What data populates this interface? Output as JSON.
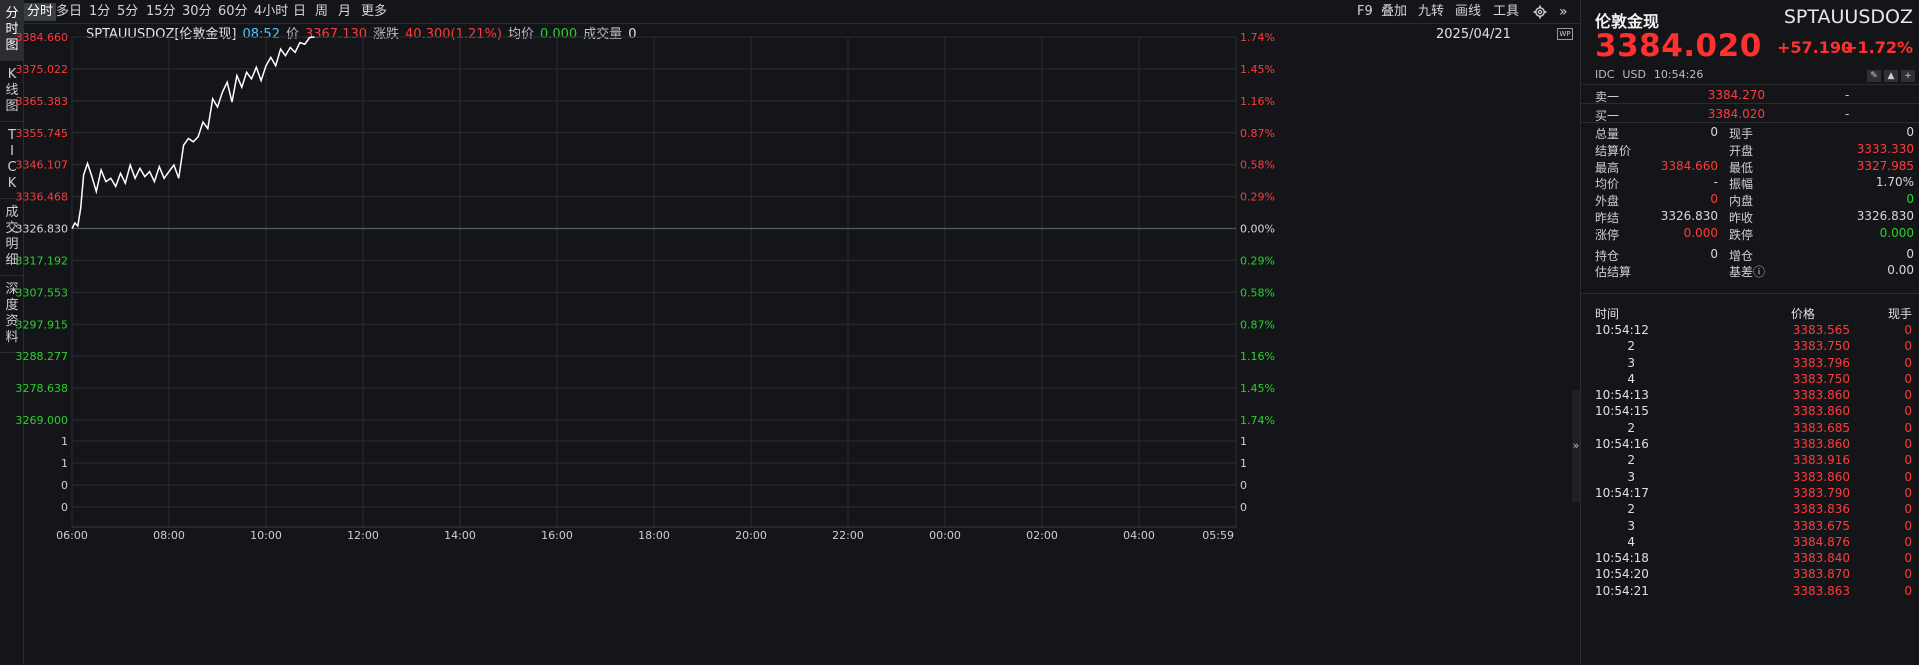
{
  "left_tabs": [
    "分时图",
    "K线图",
    "TICK",
    "成交明细",
    "深度资料"
  ],
  "toolbar": {
    "periods": [
      "分时",
      "多日",
      "1分",
      "5分",
      "15分",
      "30分",
      "60分",
      "4小时",
      "日",
      "周",
      "月",
      "更多"
    ],
    "right_buttons": [
      "F9",
      "叠加",
      "九转",
      "画线",
      "工具"
    ],
    "settings_icon": "gear-icon",
    "collapse_icon": "double-chevron-right-icon"
  },
  "info": {
    "symbol": "SPTAUUSDOZ[伦敦金现]",
    "time": "08:52",
    "price_label": "价",
    "price": "3367.130",
    "change_label": "涨跌",
    "change": "40.300(1.21%)",
    "avg_label": "均价",
    "avg": "0.000",
    "volume_label": "成交量",
    "volume": "0",
    "date": "2025/04/21",
    "wp_badge": "WP"
  },
  "colors": {
    "up": "#ff3b3b",
    "down": "#2bd12b",
    "neutral": "#d8d8d8",
    "line": "#ffffff",
    "background": "#141519",
    "grid": "#2b2d32"
  },
  "chart_data": {
    "type": "line",
    "x_ticks": [
      "06:00",
      "08:00",
      "10:00",
      "12:00",
      "14:00",
      "16:00",
      "18:00",
      "20:00",
      "22:00",
      "00:00",
      "02:00",
      "04:00",
      "05:59"
    ],
    "y_left_ticks": [
      "3384.660",
      "3375.022",
      "3365.383",
      "3355.745",
      "3346.107",
      "3336.468",
      "3326.830",
      "3317.192",
      "3307.553",
      "3297.915",
      "3288.277",
      "3278.638",
      "3269.000"
    ],
    "y_right_ticks": [
      "1.74%",
      "1.45%",
      "1.16%",
      "0.87%",
      "0.58%",
      "0.29%",
      "0.00%",
      "0.29%",
      "0.58%",
      "0.87%",
      "1.16%",
      "1.45%",
      "1.74%"
    ],
    "ylim": [
      3269.0,
      3384.66
    ],
    "base_price": 3326.83,
    "volume_ticks": [
      "1",
      "1",
      "0",
      "0"
    ],
    "series": [
      {
        "x_hours": [
          0.0,
          0.06,
          0.12,
          0.18,
          0.24,
          0.32,
          0.4,
          0.5,
          0.6,
          0.7,
          0.8,
          0.9,
          1.0,
          1.1,
          1.2,
          1.3,
          1.4,
          1.5,
          1.6,
          1.7,
          1.8,
          1.9,
          2.0,
          2.1,
          2.2,
          2.3,
          2.4,
          2.5,
          2.6,
          2.7,
          2.8,
          2.9,
          3.0,
          3.1,
          3.2,
          3.3,
          3.4,
          3.5,
          3.6,
          3.7,
          3.8,
          3.9,
          4.0,
          4.1,
          4.2,
          4.3,
          4.4,
          4.5,
          4.6,
          4.7,
          4.8,
          4.9,
          5.0
        ],
        "values": [
          3326.8,
          3328.5,
          3327.6,
          3333.0,
          3343.0,
          3346.5,
          3343.0,
          3338.0,
          3344.5,
          3341.0,
          3342.0,
          3339.5,
          3343.5,
          3340.5,
          3346.0,
          3342.0,
          3345.0,
          3342.5,
          3344.0,
          3341.0,
          3345.5,
          3342.0,
          3344.0,
          3346.0,
          3342.0,
          3352.0,
          3354.0,
          3353.0,
          3354.5,
          3359.0,
          3357.0,
          3366.0,
          3363.5,
          3368.0,
          3371.0,
          3365.0,
          3373.0,
          3369.5,
          3374.0,
          3372.0,
          3375.5,
          3371.5,
          3376.0,
          3378.5,
          3376.0,
          3381.0,
          3379.0,
          3381.5,
          3380.0,
          3383.0,
          3382.5,
          3384.5,
          3384.66
        ]
      }
    ]
  },
  "panel": {
    "name": "伦敦金现",
    "code": "SPTAUUSDOZ",
    "price": "3384.020",
    "change": "+57.190",
    "change_pct": "+1.72%",
    "source": "IDC",
    "currency": "USD",
    "time": "10:54:26",
    "sell_label": "卖一",
    "sell_price": "3384.270",
    "sell_vol": "-",
    "buy_label": "买一",
    "buy_price": "3384.020",
    "buy_vol": "-",
    "stats_left": [
      {
        "label": "总量",
        "value": "0",
        "color": "#d8d8d8"
      },
      {
        "label": "结算价",
        "value": "",
        "color": "#d8d8d8"
      },
      {
        "label": "最高",
        "value": "3384.660",
        "color": "#ff3b3b"
      },
      {
        "label": "均价",
        "value": "-",
        "color": "#d8d8d8"
      },
      {
        "label": "外盘",
        "value": "0",
        "color": "#ff3b3b"
      },
      {
        "label": "昨结",
        "value": "3326.830",
        "color": "#d8d8d8"
      },
      {
        "label": "涨停",
        "value": "0.000",
        "color": "#ff3b3b"
      },
      {
        "label": "持仓",
        "value": "0",
        "color": "#d8d8d8"
      },
      {
        "label": "估结算",
        "value": "",
        "color": "#d8d8d8"
      }
    ],
    "stats_right": [
      {
        "label": "现手",
        "value": "0",
        "color": "#d8d8d8"
      },
      {
        "label": "开盘",
        "value": "3333.330",
        "color": "#ff3b3b"
      },
      {
        "label": "最低",
        "value": "3327.985",
        "color": "#ff3b3b"
      },
      {
        "label": "振幅",
        "value": "1.70%",
        "color": "#d8d8d8"
      },
      {
        "label": "内盘",
        "value": "0",
        "color": "#2bd12b"
      },
      {
        "label": "昨收",
        "value": "3326.830",
        "color": "#d8d8d8"
      },
      {
        "label": "跌停",
        "value": "0.000",
        "color": "#2bd12b"
      },
      {
        "label": "增仓",
        "value": "0",
        "color": "#d8d8d8"
      },
      {
        "label": "基差ⓘ",
        "value": "0.00",
        "color": "#d8d8d8"
      }
    ],
    "tick_header": {
      "time": "时间",
      "price": "价格",
      "volume": "现手"
    },
    "ticks": [
      {
        "time": "10:54:12",
        "price": "3383.565",
        "vol": "0"
      },
      {
        "time": "2",
        "price": "3383.750",
        "vol": "0"
      },
      {
        "time": "3",
        "price": "3383.796",
        "vol": "0"
      },
      {
        "time": "4",
        "price": "3383.750",
        "vol": "0"
      },
      {
        "time": "10:54:13",
        "price": "3383.860",
        "vol": "0"
      },
      {
        "time": "10:54:15",
        "price": "3383.860",
        "vol": "0"
      },
      {
        "time": "2",
        "price": "3383.685",
        "vol": "0"
      },
      {
        "time": "10:54:16",
        "price": "3383.860",
        "vol": "0"
      },
      {
        "time": "2",
        "price": "3383.916",
        "vol": "0"
      },
      {
        "time": "3",
        "price": "3383.860",
        "vol": "0"
      },
      {
        "time": "10:54:17",
        "price": "3383.790",
        "vol": "0"
      },
      {
        "time": "2",
        "price": "3383.836",
        "vol": "0"
      },
      {
        "time": "3",
        "price": "3383.675",
        "vol": "0"
      },
      {
        "time": "4",
        "price": "3384.876",
        "vol": "0"
      },
      {
        "time": "10:54:18",
        "price": "3383.840",
        "vol": "0"
      },
      {
        "time": "10:54:20",
        "price": "3383.870",
        "vol": "0"
      },
      {
        "time": "10:54:21",
        "price": "3383.863",
        "vol": "0"
      }
    ],
    "collapse_handle": "»"
  }
}
